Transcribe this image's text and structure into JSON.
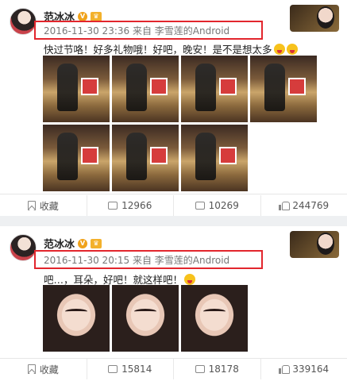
{
  "posts": [
    {
      "author": "范冰冰",
      "meta": "2016-11-30 23:36 来自 李雪莲的Android",
      "text": "快过节咯！好多礼物哦！好吧，晚安！是不是想太多",
      "image_style": "carousel",
      "image_count": 8,
      "actions": {
        "favorite": "收藏",
        "shares": "12966",
        "comments": "10269",
        "likes": "244769"
      }
    },
    {
      "author": "范冰冰",
      "meta": "2016-11-30 20:15 来自 李雪莲的Android",
      "text": "吧…，耳朵，好吧！就这样吧！",
      "image_style": "portrait",
      "image_count": 3,
      "actions": {
        "favorite": "收藏",
        "shares": "15814",
        "comments": "18178",
        "likes": "339164"
      }
    }
  ],
  "colors": {
    "highlight_border": "#e2262d",
    "badge": "#f0a21a"
  },
  "icons": [
    "avatar",
    "verified-icon",
    "crown-icon",
    "favorite-icon",
    "share-icon",
    "comment-icon",
    "like-icon"
  ]
}
